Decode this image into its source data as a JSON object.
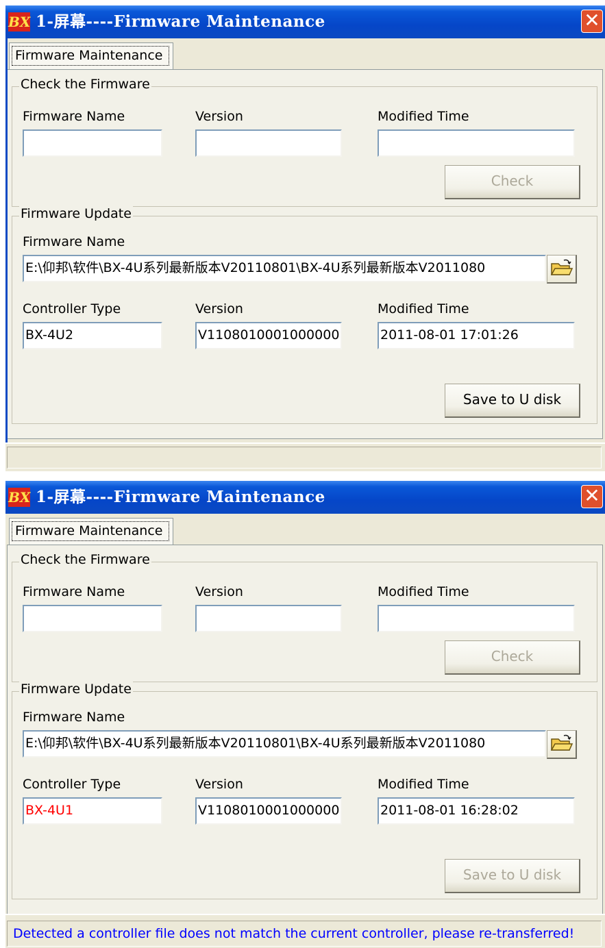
{
  "windows": [
    {
      "logo": "BX",
      "title": "1-屏幕----Firmware Maintenance",
      "close_glyph": "✕",
      "tab_label": "Firmware Maintenance",
      "check": {
        "legend": "Check the Firmware",
        "name_label": "Firmware Name",
        "version_label": "Version",
        "time_label": "Modified Time",
        "name_value": "",
        "version_value": "",
        "time_value": "",
        "check_button": "Check",
        "check_button_enabled": false
      },
      "update": {
        "legend": "Firmware Update",
        "name_label": "Firmware Name",
        "path": "E:\\仰邦\\软件\\BX-4U系列最新版本V20110801\\BX-4U系列最新版本V2011080",
        "browse_icon": "open-folder-icon",
        "controller_label": "Controller Type",
        "version_label": "Version",
        "time_label": "Modified Time",
        "controller_value": "BX-4U2",
        "controller_mismatch": false,
        "version_value": "V1108010001000000",
        "time_value": "2011-08-01 17:01:26",
        "save_button": "Save to U disk",
        "save_button_enabled": true
      },
      "status": ""
    },
    {
      "logo": "BX",
      "title": "1-屏幕----Firmware Maintenance",
      "close_glyph": "✕",
      "tab_label": "Firmware Maintenance",
      "check": {
        "legend": "Check the Firmware",
        "name_label": "Firmware Name",
        "version_label": "Version",
        "time_label": "Modified Time",
        "name_value": "",
        "version_value": "",
        "time_value": "",
        "check_button": "Check",
        "check_button_enabled": false
      },
      "update": {
        "legend": "Firmware Update",
        "name_label": "Firmware Name",
        "path": "E:\\仰邦\\软件\\BX-4U系列最新版本V20110801\\BX-4U系列最新版本V2011080",
        "browse_icon": "open-folder-icon",
        "controller_label": "Controller Type",
        "version_label": "Version",
        "time_label": "Modified Time",
        "controller_value": "BX-4U1",
        "controller_mismatch": true,
        "version_value": "V1108010001000000",
        "time_value": "2011-08-01 16:28:02",
        "save_button": "Save to U disk",
        "save_button_enabled": false
      },
      "status": "Detected a controller file does not match the current controller, please re-transferred!"
    }
  ],
  "colors": {
    "titlebar": "#0546c8",
    "window_bg": "#ece9d8",
    "mismatch_text": "#ff0000",
    "status_text": "#0000ff",
    "disabled_text": "#aca899"
  }
}
